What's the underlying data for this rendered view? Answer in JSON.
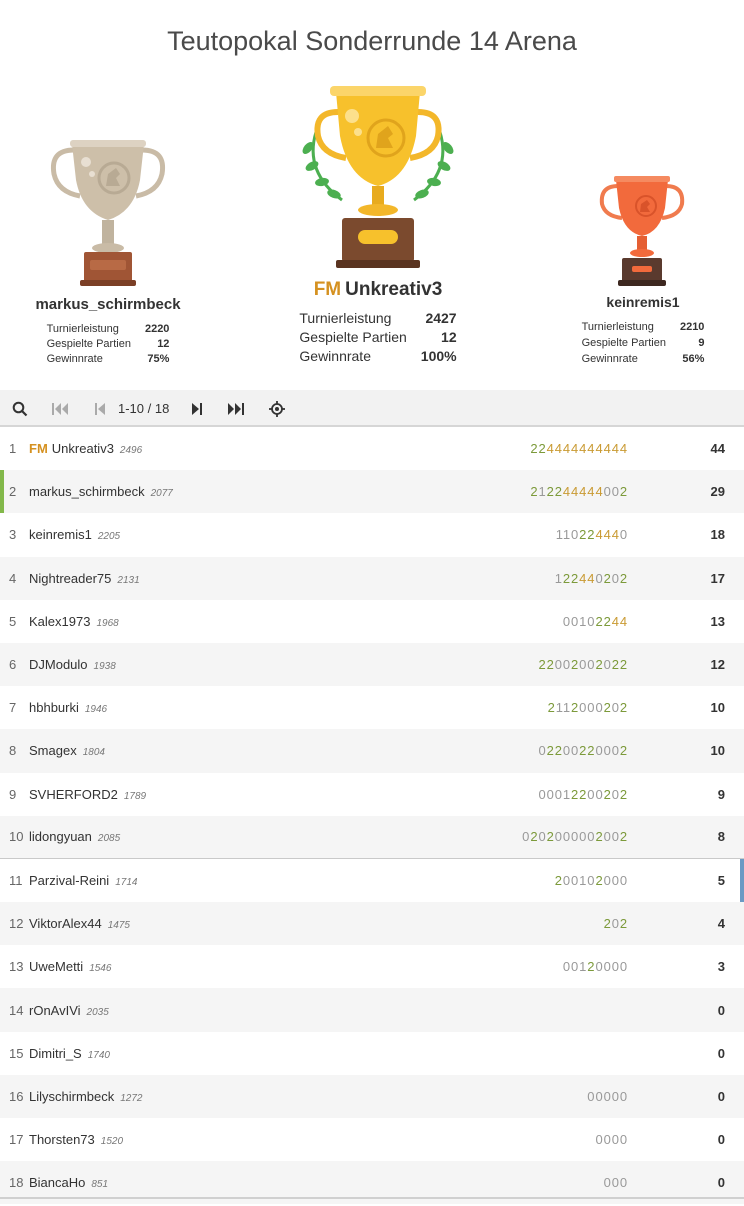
{
  "title": "Teutopokal Sonderrunde 14 Arena",
  "podium": {
    "first": {
      "title_badge": "FM",
      "name": "Unkreativ3",
      "performance_label": "Turnierleistung",
      "performance": "2427",
      "games_label": "Gespielte Partien",
      "games": "12",
      "winrate_label": "Gewinnrate",
      "winrate": "100%"
    },
    "second": {
      "name": "markus_schirmbeck",
      "performance_label": "Turnierleistung",
      "performance": "2220",
      "games_label": "Gespielte Partien",
      "games": "12",
      "winrate_label": "Gewinnrate",
      "winrate": "75%"
    },
    "third": {
      "name": "keinremis1",
      "performance_label": "Turnierleistung",
      "performance": "2210",
      "games_label": "Gespielte Partien",
      "games": "9",
      "winrate_label": "Gewinnrate",
      "winrate": "56%"
    }
  },
  "pager": {
    "info": "1-10 / 18",
    "icons": [
      "search-icon",
      "first-page-icon",
      "prev-page-icon",
      "next-page-icon",
      "last-page-icon",
      "locate-me-icon"
    ]
  },
  "colors": {
    "gold": "#d59120",
    "highlight_green": "#82b84a",
    "highlight_blue": "#6b9ac4",
    "digit_4": "#c99a32",
    "digit_2": "#7c9a3a"
  },
  "standings": [
    {
      "rank": "1",
      "title": "FM",
      "name": "Unkreativ3",
      "rating": "2496",
      "sheet": "224444444444",
      "total": "44"
    },
    {
      "rank": "2",
      "title": "",
      "name": "markus_schirmbeck",
      "rating": "2077",
      "sheet": "212244444002",
      "total": "29"
    },
    {
      "rank": "3",
      "title": "",
      "name": "keinremis1",
      "rating": "2205",
      "sheet": "110224440",
      "total": "18"
    },
    {
      "rank": "4",
      "title": "",
      "name": "Nightreader75",
      "rating": "2131",
      "sheet": "122440202",
      "total": "17"
    },
    {
      "rank": "5",
      "title": "",
      "name": "Kalex1973",
      "rating": "1968",
      "sheet": "00102244",
      "total": "13"
    },
    {
      "rank": "6",
      "title": "",
      "name": "DJModulo",
      "rating": "1938",
      "sheet": "22002002022",
      "total": "12"
    },
    {
      "rank": "7",
      "title": "",
      "name": "hbhburki",
      "rating": "1946",
      "sheet": "2112000202",
      "total": "10"
    },
    {
      "rank": "8",
      "title": "",
      "name": "Smagex",
      "rating": "1804",
      "sheet": "02200220002",
      "total": "10"
    },
    {
      "rank": "9",
      "title": "",
      "name": "SVHERFORD2",
      "rating": "1789",
      "sheet": "00012200202",
      "total": "9"
    },
    {
      "rank": "10",
      "title": "",
      "name": "lidongyuan",
      "rating": "2085",
      "sheet": "0202000002002",
      "total": "8"
    },
    {
      "rank": "11",
      "title": "",
      "name": "Parzival-Reini",
      "rating": "1714",
      "sheet": "200102000",
      "total": "5"
    },
    {
      "rank": "12",
      "title": "",
      "name": "ViktorAlex44",
      "rating": "1475",
      "sheet": "202",
      "total": "4"
    },
    {
      "rank": "13",
      "title": "",
      "name": "UweMetti",
      "rating": "1546",
      "sheet": "00120000",
      "total": "3"
    },
    {
      "rank": "14",
      "title": "",
      "name": "rOnAvIVi",
      "rating": "2035",
      "sheet": "",
      "total": "0"
    },
    {
      "rank": "15",
      "title": "",
      "name": "Dimitri_S",
      "rating": "1740",
      "sheet": "",
      "total": "0"
    },
    {
      "rank": "16",
      "title": "",
      "name": "Lilyschirmbeck",
      "rating": "1272",
      "sheet": "00000",
      "total": "0"
    },
    {
      "rank": "17",
      "title": "",
      "name": "Thorsten73",
      "rating": "1520",
      "sheet": "0000",
      "total": "0"
    },
    {
      "rank": "18",
      "title": "",
      "name": "BiancaHo",
      "rating": "851",
      "sheet": "000",
      "total": "0"
    }
  ]
}
